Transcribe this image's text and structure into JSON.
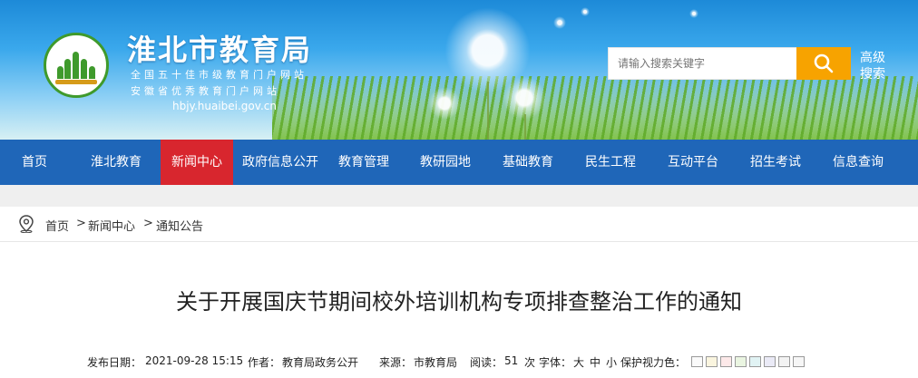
{
  "header": {
    "site_name": "淮北市教育局",
    "honor_1": "全国五十佳市级教育门户网站",
    "honor_2": "安徽省优秀教育门户网站",
    "url": "hbjy.huaibei.gov.cn",
    "search_placeholder": "请输入搜索关键字",
    "advanced_search": "高级搜索"
  },
  "nav": {
    "items": [
      "首页",
      "淮北教育",
      "新闻中心",
      "政府信息公开",
      "教育管理",
      "教研园地",
      "基础教育",
      "民生工程",
      "互动平台",
      "招生考试",
      "信息查询"
    ],
    "active": "新闻中心",
    "colors": {
      "bar": "#1f66b8",
      "active": "#d8262e"
    }
  },
  "breadcrumb": {
    "home": "首页",
    "sep": ">",
    "section": "新闻中心",
    "current": "通知公告"
  },
  "article": {
    "title": "关于开展国庆节期间校外培训机构专项排查整治工作的通知",
    "meta": {
      "publish_label": "发布日期：",
      "publish_date": "2021-09-28 15:15",
      "author_label": "作者：",
      "author": "教育局政务公开",
      "source_label": "来源：",
      "source": "市教育局",
      "views_label": "阅读：",
      "views": "51",
      "views_unit": "次",
      "font_label": "字体：",
      "font_large": "大",
      "font_medium": "中",
      "font_small": "小",
      "eye_label": "保护视力色："
    },
    "eye_colors": [
      "#fafafa",
      "#faf5df",
      "#fde9e9",
      "#eaf5e1",
      "#e1f3f4",
      "#eaeaf6",
      "#f3f3f3",
      "#f6f6f6"
    ]
  }
}
